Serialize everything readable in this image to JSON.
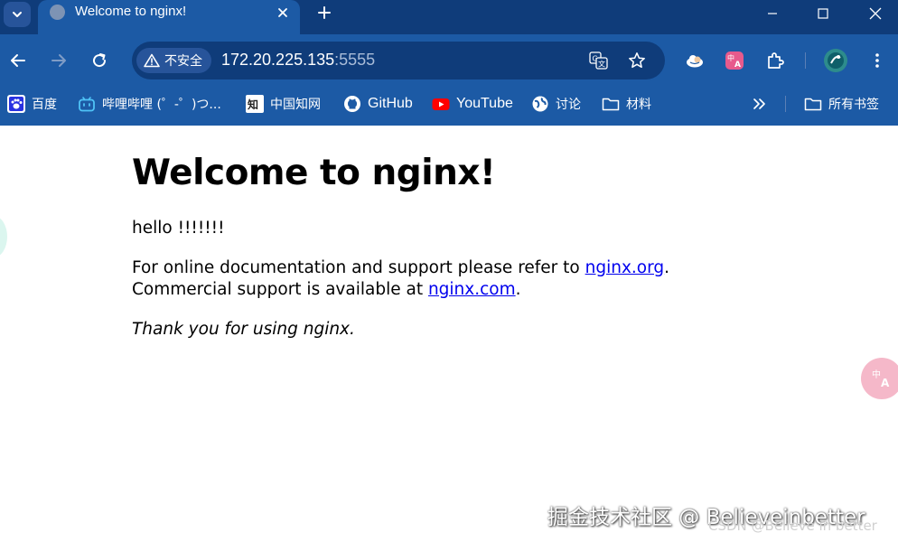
{
  "browser": {
    "active_tab": {
      "title": "Welcome to nginx!"
    },
    "toolbar": {
      "security_label": "不安全",
      "url_host": "172.20.225.135",
      "url_port": ":5555"
    },
    "bookmarks": [
      {
        "label": "百度",
        "icon": "baidu-icon"
      },
      {
        "label": "哔哩哔哩 (゜-゜)つ...",
        "icon": "bilibili-icon"
      },
      {
        "label": "中国知网",
        "icon": "cnki-icon"
      },
      {
        "label": "GitHub",
        "icon": "github-icon"
      },
      {
        "label": "YouTube",
        "icon": "youtube-icon"
      },
      {
        "label": "讨论",
        "icon": "globe-icon"
      },
      {
        "label": "材料",
        "icon": "folder-icon"
      }
    ],
    "all_bookmarks_label": "所有书签"
  },
  "page": {
    "heading": "Welcome to nginx!",
    "hello": "hello !!!!!!!",
    "doc_text": "For online documentation and support please refer to ",
    "doc_link": "nginx.org",
    "doc_end": ".",
    "commercial_text": "Commercial support is available at ",
    "commercial_link": "nginx.com",
    "commercial_end": ".",
    "thanks": "Thank you for using nginx."
  },
  "watermark": {
    "primary": "掘金技术社区 @ Believeinbetter",
    "secondary": "CSDN @Believe in better"
  },
  "colors": {
    "tab_strip": "#0f3c7a",
    "toolbar": "#1c5aa5",
    "link": "#0000ee"
  }
}
